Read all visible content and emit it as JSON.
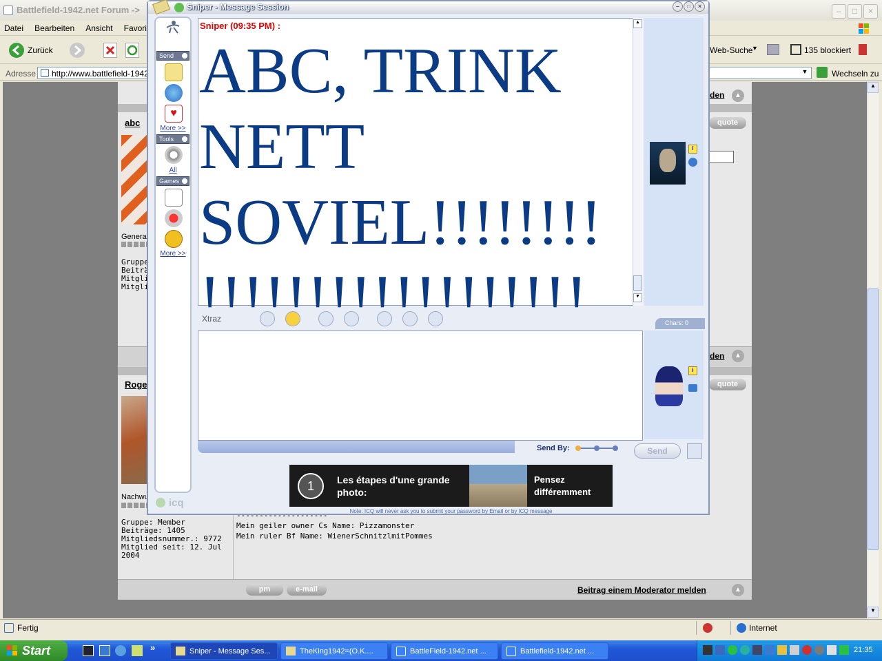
{
  "ie": {
    "title": "Battlefield-1942.net Forum ->",
    "menu": [
      "Datei",
      "Bearbeiten",
      "Ansicht",
      "Favorite"
    ],
    "toolbar": {
      "back_label": "Zurück",
      "websearch_label": "Web-Suche",
      "blocked_label": "135 blockiert"
    },
    "address": {
      "label": "Adresse",
      "url": "http://www.battlefield-1942.",
      "go_label": "Wechseln zu"
    },
    "status": {
      "text": "Fertig",
      "zone": "Internet"
    }
  },
  "forum": {
    "post1": {
      "author": "abc",
      "rank_fragment": "Genera",
      "info_fragments": [
        "Gruppe",
        "Beiträg",
        "Mitglie",
        "Mitglie"
      ],
      "report_fragment": "den",
      "quote_label": "quote"
    },
    "post2": {
      "author": "Roge",
      "rank_fragment": "Nachwu",
      "group": "Gruppe: Member",
      "posts": "Beiträge: 1405",
      "member_no": "Mitgliedsnummer.: 9772",
      "member_since": "Mitglied seit: 12. Jul 2004",
      "signature_sep": "--------------------",
      "signature_line1": "Mein geiler owner Cs Name: Pizzamonster",
      "signature_line2": "Mein ruler Bf Name: WienerSchnitzlmitPommes",
      "pm_label": "pm",
      "email_label": "e-mail",
      "report_label": "Beitrag einem Moderator melden",
      "report_fragment": "den",
      "quote_label": "quote"
    }
  },
  "icq": {
    "title": "Sniper - Message Session",
    "sidebar": {
      "send_label": "Send",
      "tools_label": "Tools",
      "games_label": "Games",
      "more1": "More >>",
      "all": "All",
      "more2": "More >>",
      "brand": "icq"
    },
    "message": {
      "header": "Sniper (09:35 PM) :",
      "body": "ABC, TRINK NETT SOVIEL!!!!!!!! !!!!!!!!!!!!!!!!!!"
    },
    "toolbar": {
      "xtraz": "Xtraz",
      "chars_label": "Chars:",
      "chars_value": "0"
    },
    "send": {
      "send_by_label": "Send By:",
      "send_button": "Send"
    },
    "ad": {
      "number": "1",
      "left_text": "Les étapes d'une grande photo:",
      "right_text": "Pensez différemment"
    },
    "note": "Note: ICQ will never ask you to submit your password by Email or by ICQ message"
  },
  "taskbar": {
    "start": "Start",
    "tasks": [
      "Sniper - Message Ses...",
      "TheKing1942=(O.K....",
      "BattleField-1942.net ...",
      "Battlefield-1942.net ..."
    ],
    "clock": "21:35"
  }
}
